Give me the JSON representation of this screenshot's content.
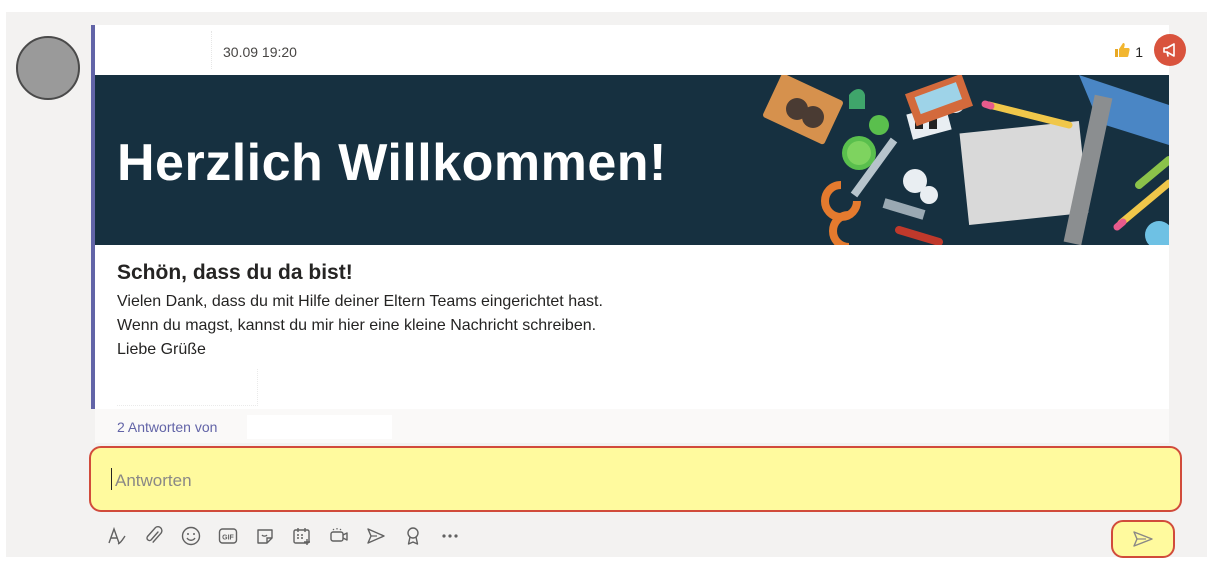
{
  "message": {
    "timestamp": "30.09 19:20",
    "reaction_count": "1",
    "reaction_icon": "thumbs-up-icon",
    "banner_title": "Herzlich Willkommen!",
    "heading": "Schön, dass du da bist!",
    "lines": [
      "Vielen Dank, dass du mit Hilfe deiner Eltern Teams eingerichtet hast.",
      "Wenn du magst, kannst du mir hier eine kleine Nachricht schreiben.",
      "Liebe Grüße"
    ]
  },
  "replies": {
    "link_text": "2 Antworten von"
  },
  "reply_box": {
    "placeholder": "Antworten",
    "value": ""
  },
  "toolbar": {
    "icons": [
      "format-icon",
      "attach-icon",
      "emoji-icon",
      "gif-icon",
      "sticker-icon",
      "schedule-meeting-icon",
      "meet-now-icon",
      "stream-icon",
      "praise-icon",
      "more-options-icon"
    ]
  },
  "colors": {
    "accent": "#6264a7",
    "banner_bg": "#163040",
    "highlight_fill": "#fffa9e",
    "highlight_border": "#d14b3b",
    "announcement_badge": "#d9533d"
  }
}
